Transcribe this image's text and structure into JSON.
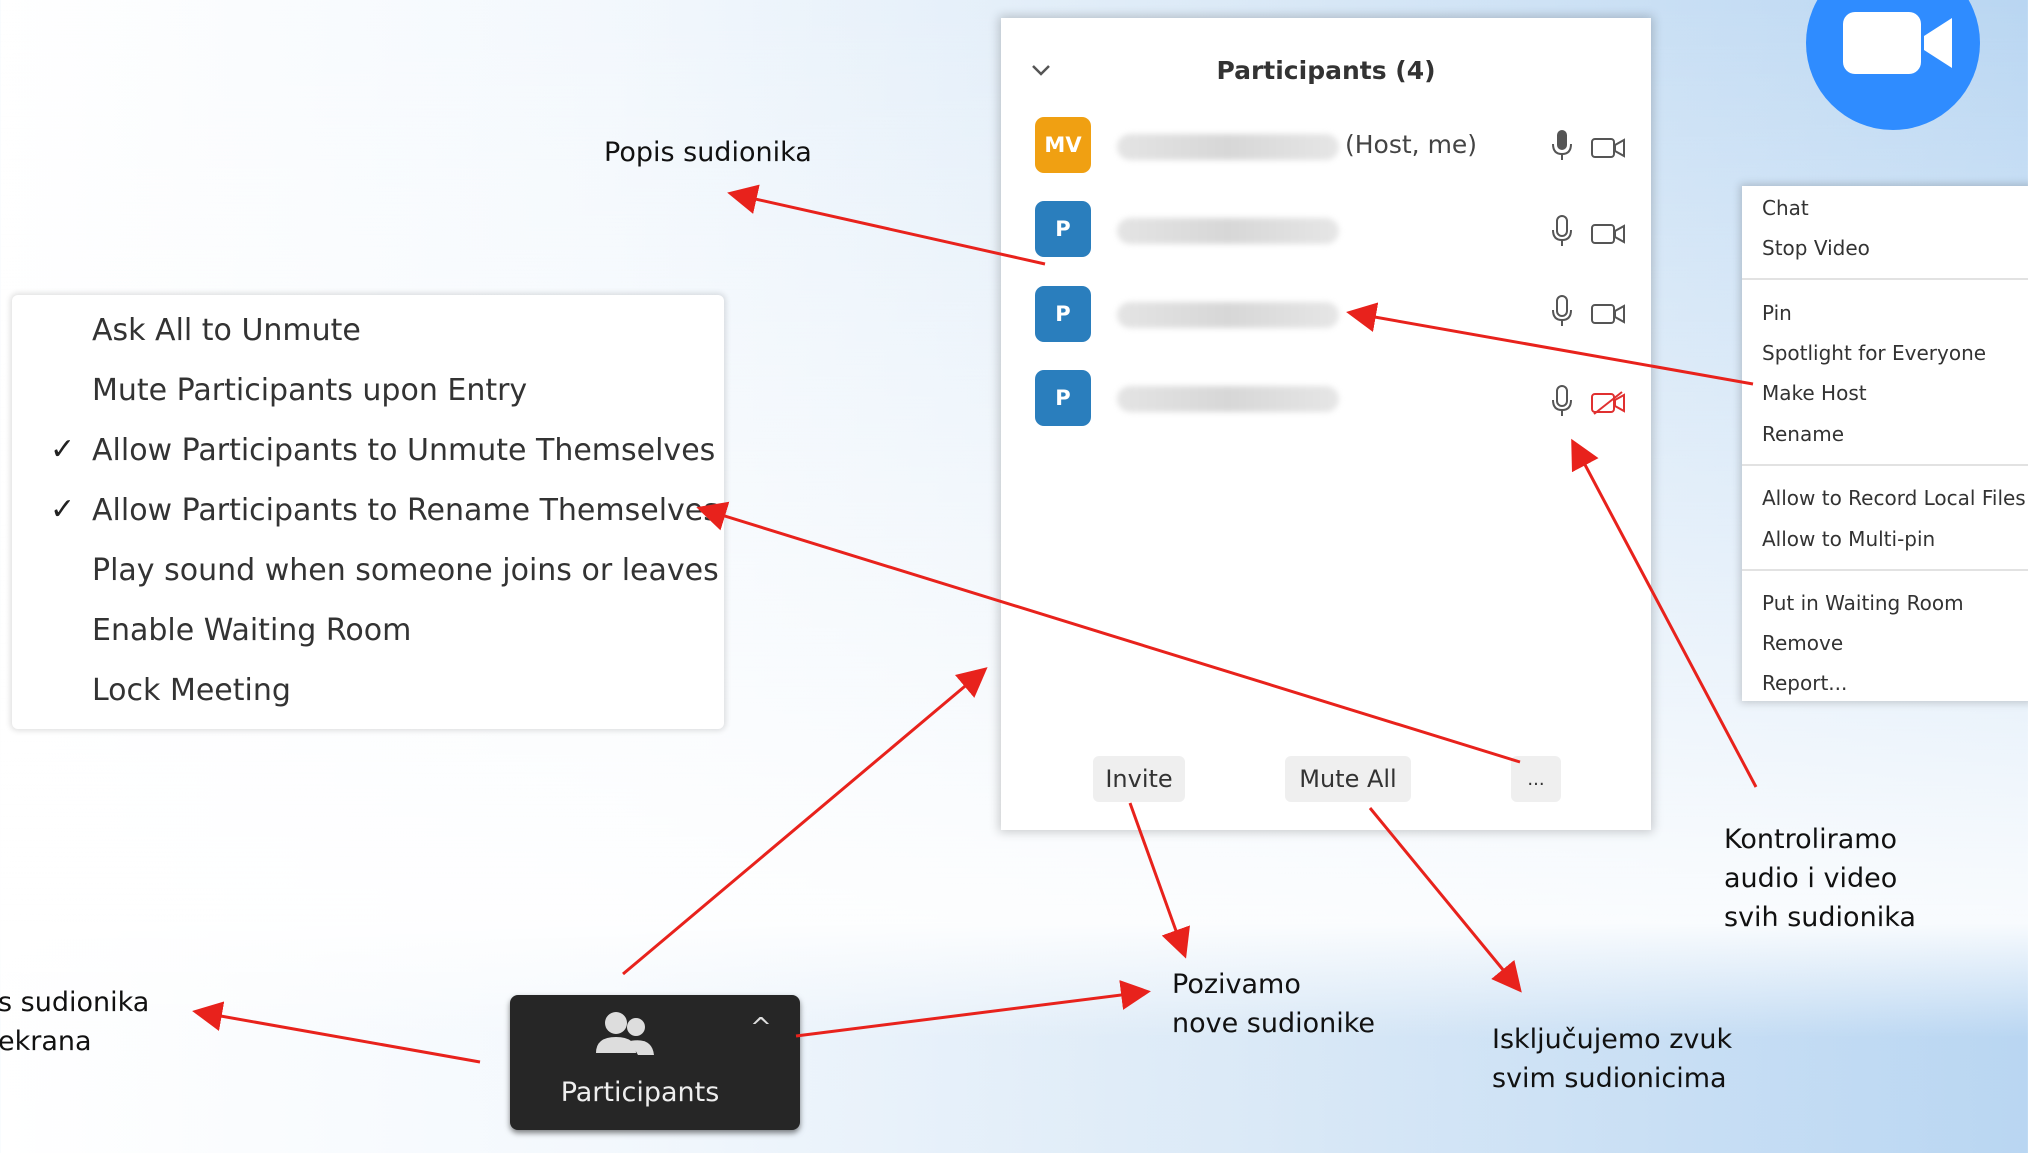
{
  "options_menu": {
    "items": [
      {
        "label": "Ask All to Unmute",
        "checked": false
      },
      {
        "label": "Mute Participants upon Entry",
        "checked": false
      },
      {
        "label": "Allow Participants to Unmute Themselves",
        "checked": true
      },
      {
        "label": "Allow Participants to Rename Themselves",
        "checked": true
      },
      {
        "label": "Play sound when someone joins or leaves",
        "checked": false
      },
      {
        "label": "Enable Waiting Room",
        "checked": false
      },
      {
        "label": "Lock Meeting",
        "checked": false
      }
    ],
    "check_glyph": "✓"
  },
  "participants_panel": {
    "title": "Participants (4)",
    "collapse_icon": "chevron-down-icon",
    "participants": [
      {
        "initials": "MV",
        "tag": "(Host, me)",
        "avatar_color": "#f0a012",
        "mic": "mic-on",
        "video": "video-on"
      },
      {
        "initials": "P",
        "tag": "",
        "avatar_color": "#2a7ebd",
        "mic": "mic-off",
        "video": "video-on"
      },
      {
        "initials": "P",
        "tag": "",
        "avatar_color": "#2a7ebd",
        "mic": "mic-off",
        "video": "video-on"
      },
      {
        "initials": "P",
        "tag": "",
        "avatar_color": "#2a7ebd",
        "mic": "mic-off",
        "video": "video-off"
      }
    ],
    "buttons": {
      "invite": "Invite",
      "mute_all": "Mute All",
      "more": "..."
    }
  },
  "context_menu": {
    "items": [
      "Chat",
      "Stop Video",
      "Pin",
      "Spotlight for Everyone",
      "Make Host",
      "Rename",
      "Allow to Record Local Files",
      "Allow to Multi-pin",
      "Put in Waiting Room",
      "Remove",
      "Report..."
    ]
  },
  "toolbar": {
    "participants_label": "Participants",
    "caret": "^"
  },
  "annotations": {
    "popis": "Popis sudionika",
    "kontrola": [
      "Kontroliramo",
      "audio i video",
      "svih sudionika"
    ],
    "pozivamo": [
      "Pozivamo",
      "nove sudionike"
    ],
    "iskljucujemo": [
      "Isključujemo zvuk",
      "svim sudionicima"
    ],
    "left_cut": [
      "s sudionika",
      "ekrana"
    ]
  },
  "colors": {
    "arrow": "#e8221c",
    "zoom_blue": "#2f8cff",
    "video_off": "#e03030"
  }
}
